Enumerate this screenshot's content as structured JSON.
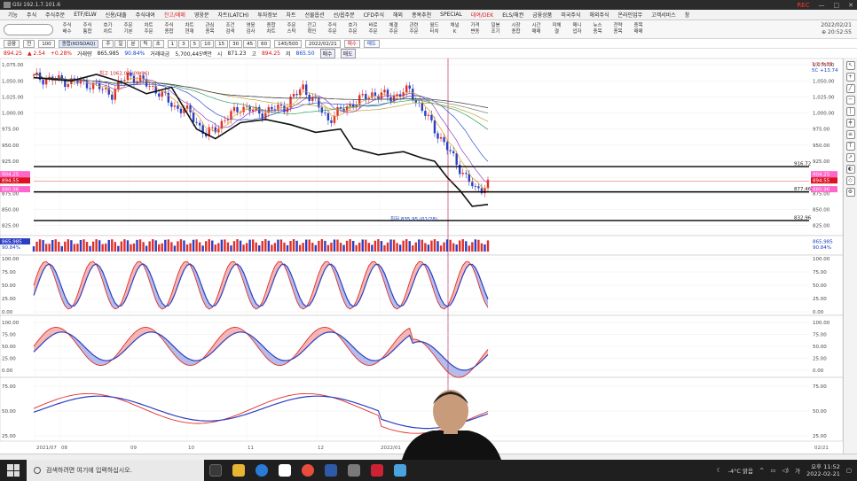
{
  "window": {
    "title": "GSI  192.1.7.101.6",
    "rec_label": "REC"
  },
  "menu": {
    "items": [
      "기능",
      "주식",
      "주식주문",
      "ETF/ELW",
      "신용/대출",
      "주식대여",
      "잔고/매매",
      "영웅문",
      "차트(LATCH)",
      "투자정보",
      "차트",
      "선물옵션",
      "선/옵주문",
      "CFD주식",
      "해외",
      "종목추천",
      "SPECIAL",
      "대여/DEK",
      "ELS/채권",
      "금융상품",
      "미국주식",
      "해외주식",
      "온라인업무",
      "고객서비스",
      "창"
    ],
    "highlighted": [
      "잔고/매매",
      "대여/DEK"
    ]
  },
  "toolbar": {
    "items": [
      "주식 배수",
      "주식 통합",
      "호가 차트",
      "주문 기본",
      "차트 주문",
      "주식 종합",
      "차트 현재",
      "관심 종목",
      "조건 검색",
      "영웅 검사",
      "종합 차트",
      "주문 스탁",
      "잔고 확인",
      "주식 주문",
      "호가 주문",
      "바로 주문",
      "체결 주문",
      "관련 주문",
      "월드 터치",
      "채널 K",
      "가격 변동",
      "일봉 조기",
      "시장 종합",
      "시간 매매",
      "미체 결",
      "매니 업자",
      "뉴스 종목",
      "전략 종목",
      "종목 매매"
    ],
    "date_top": "2022/02/21",
    "time_top": "⊕ 20:52:55"
  },
  "controls": {
    "code": "금융",
    "period_label": "전",
    "count": "100",
    "name_field": "종합(KOSDAQ)",
    "interval_buttons": [
      "주",
      "일",
      "분",
      "틱",
      "초"
    ],
    "minutes": [
      "1",
      "3",
      "5",
      "10",
      "15",
      "30",
      "45",
      "60"
    ],
    "range": "145/500",
    "date": "2022/02/21",
    "buy_button": "매수",
    "sell_button": "매도"
  },
  "pricebar": {
    "last": "894.25",
    "change": "▲ 2.54",
    "pct": "+0.28%",
    "vol_label": "거래량",
    "volume": "865,985",
    "pct2": "90.84%",
    "amount_label": "거래대금",
    "amount": "5,700,445백만",
    "open_label": "시",
    "open": "871.23",
    "high_label": "고",
    "high": "894.25",
    "low_label": "저",
    "low": "865.50",
    "badge1": "매수",
    "badge2": "매도"
  },
  "chart_data": {
    "type": "line",
    "price_axis": {
      "ticks": [
        "1,075.00",
        "1,050.00",
        "1,025.00",
        "1,000.00",
        "975.00",
        "950.00",
        "925.00",
        "900.00",
        "875.00",
        "850.00",
        "825.00"
      ],
      "range": [
        815,
        1082
      ],
      "annotations": {
        "high_label": "최고 1062.03 (09/06)",
        "low_label": "최저 835.95 (01/28)",
        "level_916": "916.72",
        "level_877": "877.46",
        "level_832": "832.96",
        "right_label_top": "1/C 5.83",
        "right_label_top2": "5C +13.74"
      },
      "left_price_tags": [
        "904.25",
        "894.55",
        "880.96"
      ]
    },
    "volume_axis": {
      "tag_left": "865,985",
      "tag_left2": "90.84%"
    },
    "stoch1_axis": {
      "ticks": [
        "100.00",
        "75.00",
        "50.00",
        "25.00",
        "0.00"
      ]
    },
    "stoch2_axis": {
      "ticks": [
        "100.00",
        "75.00",
        "50.00",
        "25.00",
        "0.00"
      ]
    },
    "macd_axis": {
      "ticks": [
        "75.00",
        "50.00",
        "25.00"
      ]
    },
    "x_ticks": [
      "2021/07",
      "08",
      "09",
      "10",
      "11",
      "12",
      "2022/01",
      "02"
    ],
    "x_tick_right": "02/21",
    "colors": {
      "up": "#e0302a",
      "down": "#2c3fc4",
      "ma_black": "#111111",
      "level_line": "#000000"
    }
  },
  "taskbar": {
    "search_placeholder": "검색하려면 여기에 입력하십시오.",
    "weather": "-4°C 맑음",
    "time": "오후 11:52",
    "date": "2022-02-21",
    "ime": "가"
  }
}
